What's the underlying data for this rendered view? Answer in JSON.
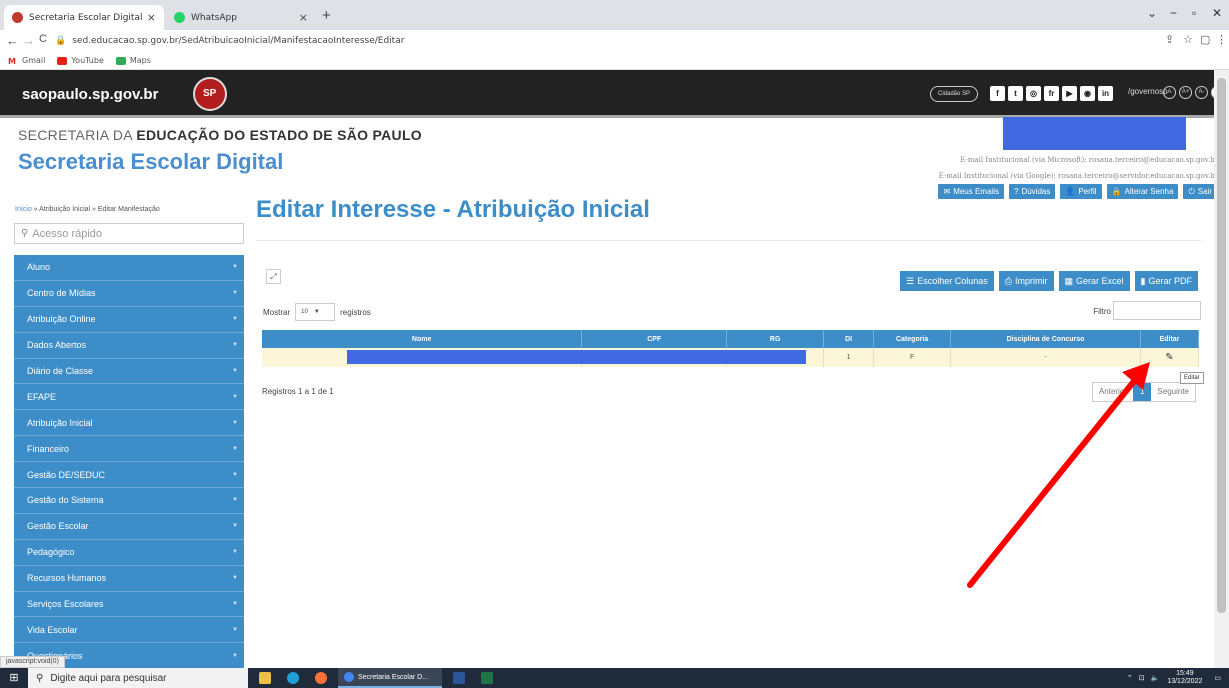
{
  "browser": {
    "tabs": [
      {
        "label": "Secretaria Escolar Digital",
        "active": true
      },
      {
        "label": "WhatsApp",
        "active": false
      }
    ],
    "url": "sed.educacao.sp.gov.br/SedAtribuicaoInicial/ManifestacaoInteresse/Editar",
    "bookmarks": [
      "Gmail",
      "YouTube",
      "Maps"
    ],
    "status_text": "javascript:void(0)"
  },
  "gov_header": {
    "site": "saopaulo.sp.gov.br",
    "seal_text": "SP",
    "cidadao": "Cidadão SP",
    "social_handle": "/governosp"
  },
  "header": {
    "department_prefix": "SECRETARIA DA ",
    "department_bold": "EDUCAÇÃO DO ESTADO DE SÃO PAULO",
    "app_title": "Secretaria Escolar Digital",
    "email_microsoft": "E-mail Institucional (via Microsoft): rosana.terceiro@educacao.sp.gov.br",
    "email_google": "E-mail Institucional (via Google): rosana.terceiro@servidor.educacao.sp.gov.br",
    "buttons": [
      "Meus Emails",
      "Dúvidas",
      "Perfil",
      "Alterar Senha",
      "Sair"
    ]
  },
  "breadcrumb": {
    "home": "Início",
    "sep": " » ",
    "level1": "Atribuição Inicial",
    "level2": "Editar Manifestação"
  },
  "sidebar": {
    "quick_placeholder": "Acesso rápido",
    "items": [
      "Aluno",
      "Centro de Mídias",
      "Atribuição Online",
      "Dados Abertos",
      "Diário de Classe",
      "EFAPE",
      "Atribuição Inicial",
      "Financeiro",
      "Gestão DE/SEDUC",
      "Gestão do Sistema",
      "Gestão Escolar",
      "Pedagógico",
      "Recursos Humanos",
      "Serviços Escolares",
      "Vida Escolar",
      "Questionários"
    ]
  },
  "main": {
    "title": "Editar Interesse - Atribuição Inicial",
    "actions": [
      "Escolher Colunas",
      "Imprimir",
      "Gerar Excel",
      "Gerar PDF"
    ],
    "show_label": "Mostrar",
    "page_size": "10",
    "records_label": "registros",
    "filter_label": "Filtro",
    "table": {
      "columns": [
        "Nome",
        "CPF",
        "RG",
        "DI",
        "Categoria",
        "Disciplina de Concurso",
        "Editar"
      ],
      "rows": [
        {
          "nome": "",
          "cpf": "",
          "rg": "",
          "di": "1",
          "categoria": "F",
          "disciplina": "-"
        }
      ]
    },
    "info": "Registros 1 a 1 de 1",
    "pager": {
      "prev": "Anterior",
      "current": "1",
      "next": "Seguinte"
    },
    "tooltip": "Editar"
  },
  "taskbar": {
    "search_placeholder": "Digite aqui para pesquisar",
    "app_label": "Secretaria Escolar D...",
    "time": "15:49",
    "date": "13/12/2022"
  },
  "colors": {
    "accent": "#3c8dc8",
    "redaction": "#4169e1",
    "arrow": "#ff0000",
    "row_highlight": "#fcf6d8"
  }
}
